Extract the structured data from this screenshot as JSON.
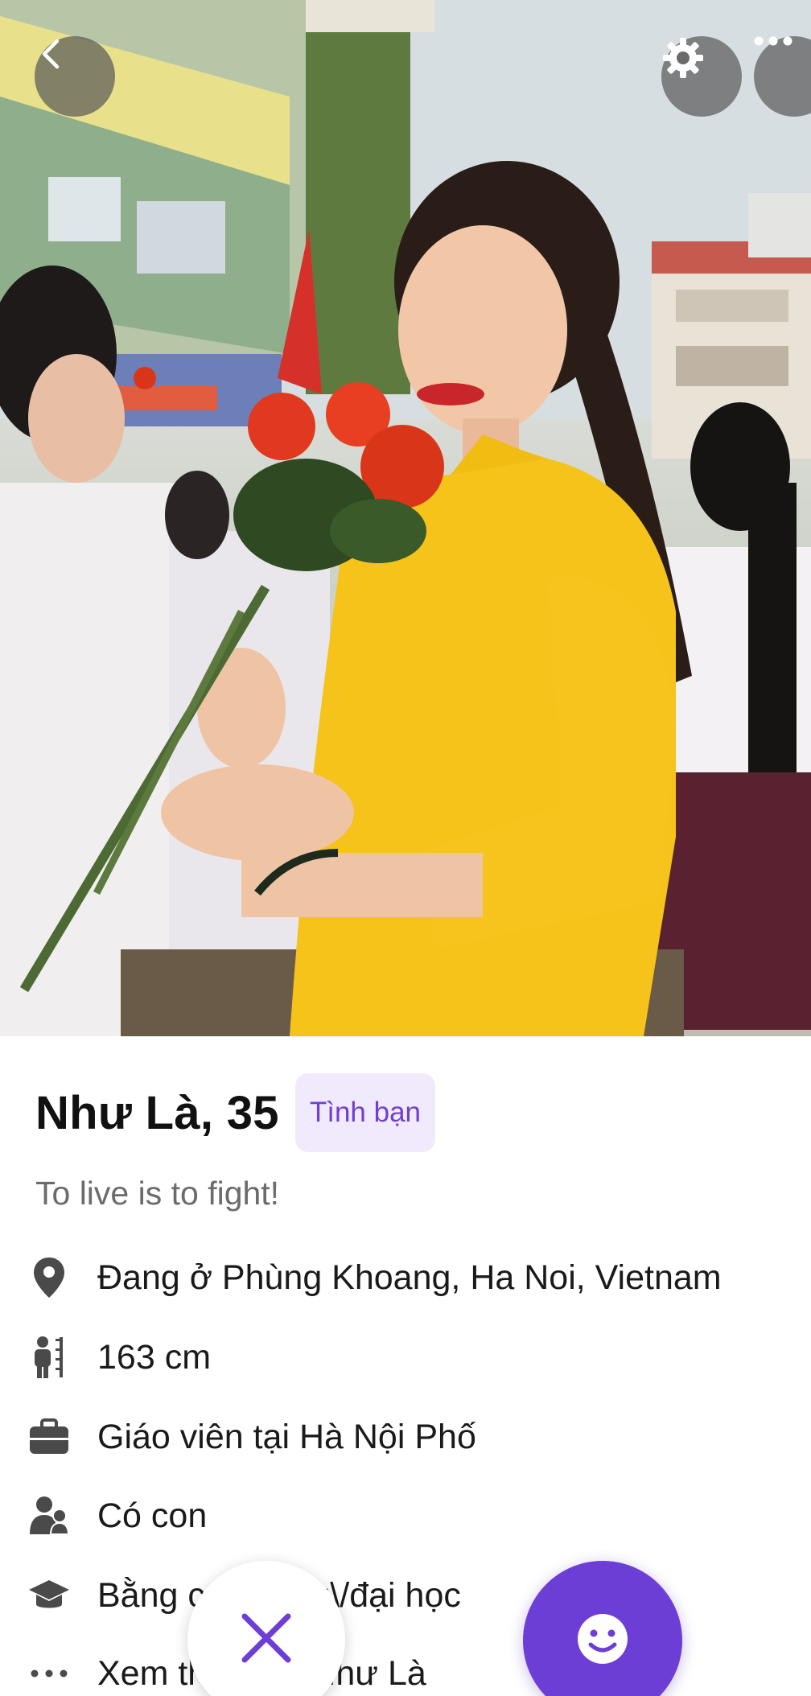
{
  "profile": {
    "name_age": "Như Là, 35",
    "intent_badge": "Tình bạn",
    "tagline": "To live is to fight!"
  },
  "details": [
    {
      "icon": "location-pin-icon",
      "text": "Đang ở Phùng Khoang, Ha Noi, Vietnam"
    },
    {
      "icon": "height-icon",
      "text": "163 cm"
    },
    {
      "icon": "briefcase-icon",
      "text": "Giáo viên tại Hà Nội Phố"
    },
    {
      "icon": "children-icon",
      "text": "Có con"
    },
    {
      "icon": "graduation-cap-icon",
      "text": "Bằng cao đẳng\\/đại học"
    },
    {
      "icon": "more-dots-icon",
      "text": "Xem thêm về Như Là"
    }
  ],
  "toolbar": {
    "back_icon": "chevron-left-icon",
    "settings_icon": "gear-icon",
    "more_icon": "ellipsis-icon"
  },
  "actions": {
    "dislike_icon": "close-icon",
    "like_icon": "smiley-icon"
  },
  "colors": {
    "accent": "#6c3ed6",
    "badge_bg": "#f1eafc",
    "badge_text": "#6e3fd1",
    "overlay_button": "#5a5a5a"
  }
}
